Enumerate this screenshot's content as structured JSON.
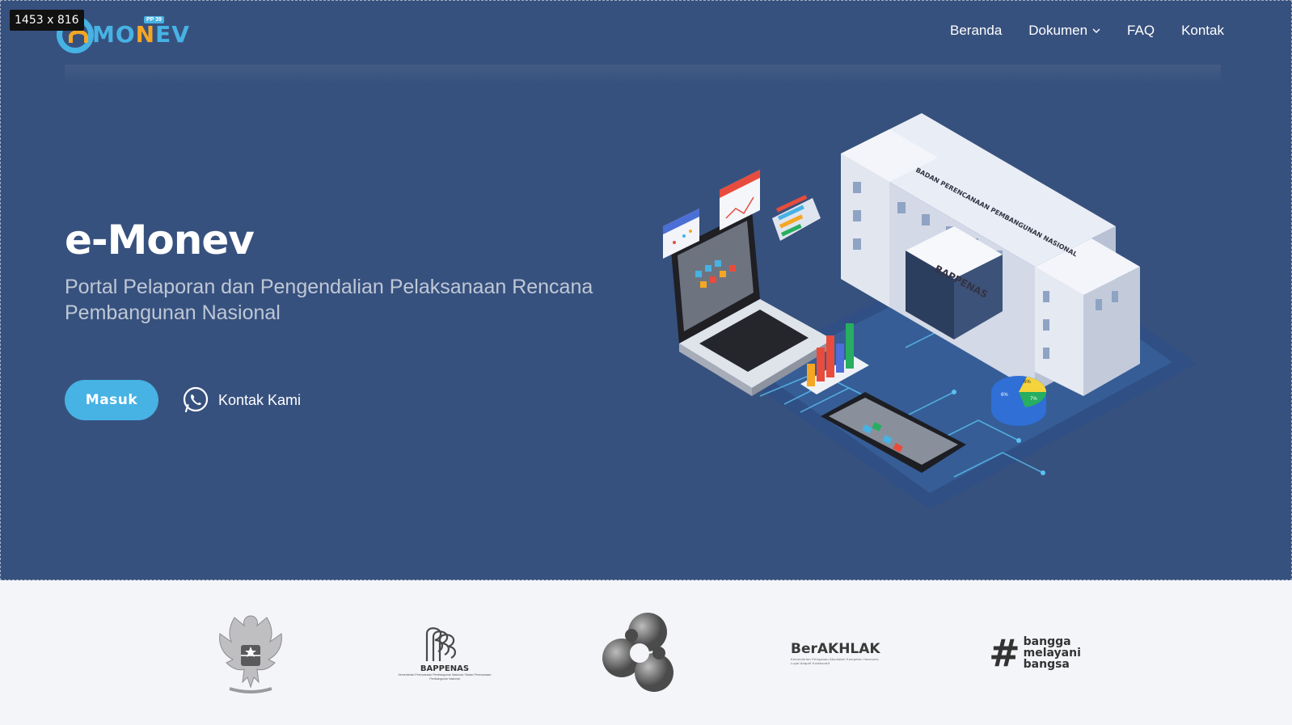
{
  "overlay": {
    "dimension_badge": "1453 x 816"
  },
  "brand": {
    "logo_text_mo": "MO",
    "logo_text_n": "N",
    "logo_text_ev": "EV",
    "logo_tag": "PP 39",
    "primary_color": "#37517e",
    "accent_color": "#47b2e4"
  },
  "nav": {
    "items": [
      {
        "label": "Beranda"
      },
      {
        "label": "Dokumen",
        "icon": "chevron-down-icon"
      },
      {
        "label": "FAQ"
      },
      {
        "label": "Kontak"
      }
    ]
  },
  "hero": {
    "title": "e-Monev",
    "subtitle": "Portal Pelaporan dan Pengendalian Pelaksanaan Rencana Pembangunan Nasional",
    "primary_button": "Masuk",
    "contact_button": "Kontak Kami",
    "contact_icon": "whatsapp-icon",
    "illustration": {
      "building_sign": "BADAN PERENCANAAN PEMBANGUNAN NASIONAL",
      "building_name": "BAPPENAS",
      "pie_labels": [
        "6%",
        "6%",
        "7%"
      ]
    }
  },
  "clients": {
    "bappenas_name": "BAPPENAS",
    "bappenas_sub": "Kementerian Perencanaan Pembangunan Nasional / Badan Perencanaan Pembangunan Nasional",
    "berakhlak": "BerAKHLAK",
    "berakhlak_sub": "Kementerian Pelayanan Akuntabel Kompeten Harmonis Loyal Adaptif Kolaboratif",
    "bangga_hash": "#",
    "bangga_words": [
      "bangga",
      "melayani",
      "bangsa"
    ]
  }
}
